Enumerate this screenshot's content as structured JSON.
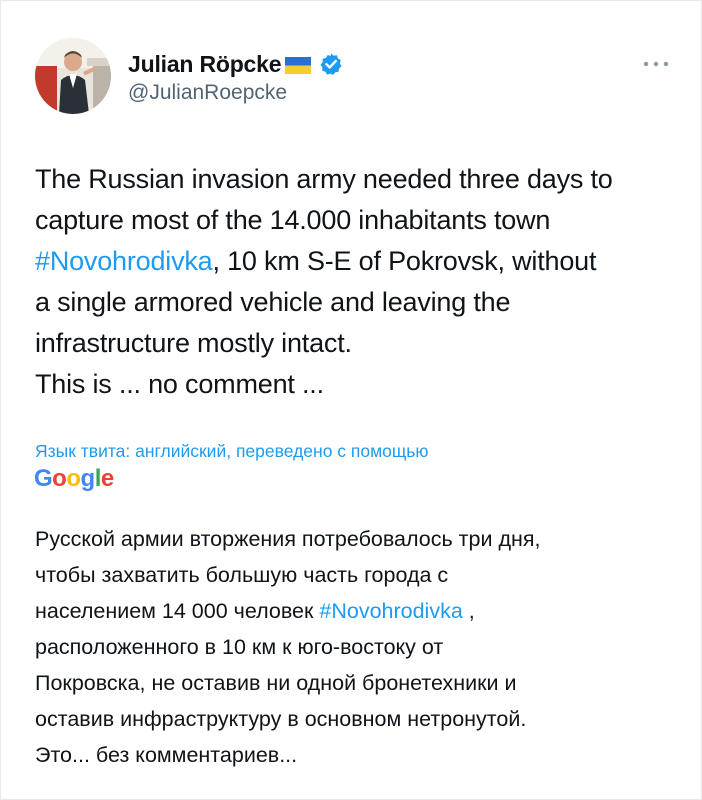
{
  "author": {
    "name": "Julian Röpcke",
    "handle": "@JulianRoepcke",
    "flag_icon": "ukraine-flag-icon",
    "verified_icon": "verified-badge-icon",
    "verified_color": "#1d9bf0"
  },
  "tweet": {
    "line1": "The Russian invasion army needed three days to",
    "line2": "capture most of the 14.000 inhabitants town",
    "line3_hashtag": "#Novohrodivka",
    "line3_rest": ", 10 km S-E of Pokrovsk, without",
    "line4": "a single armored vehicle and leaving the",
    "line5": "infrastructure mostly intact.",
    "line6": "This is ... no comment ..."
  },
  "translation": {
    "note": "Язык твита: английский, переведено с помощью",
    "provider": "Google",
    "line1": "Русской армии вторжения потребовалось три дня,",
    "line2": "чтобы захватить большую часть города с",
    "line3_pre": "населением 14 000 человек ",
    "line3_hashtag": "#Novohrodivka",
    "line3_post": " ,",
    "line4": "расположенного в 10 км к юго-востоку от",
    "line5": "Покровска, не оставив ни одной бронетехники и",
    "line6": "оставив инфраструктуру в основном нетронутой.",
    "line7": "Это... без комментариев..."
  },
  "colors": {
    "link": "#1d9bf0",
    "text": "#0f1419",
    "secondary": "#536471",
    "google_blue": "#4285f4",
    "google_red": "#ea4335",
    "google_yellow": "#fbbc05",
    "google_green": "#34a853"
  },
  "icons": {
    "more": "more-options-icon"
  }
}
